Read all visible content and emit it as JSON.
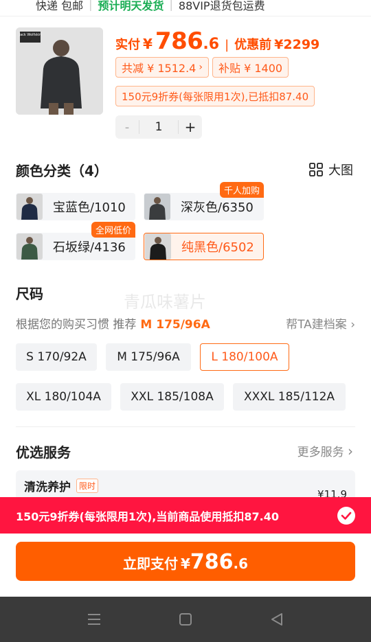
{
  "delivery": {
    "item1": "快递 包邮",
    "item2": "预计明天发货",
    "item3": "88VIP退货包运费"
  },
  "product": {
    "brand_logo": "Jack Wolfskin",
    "paid_label": "实付",
    "currency": "¥",
    "price_int": "786",
    "price_dec": ".6",
    "before_label": "优惠前",
    "before_price": "¥2299",
    "total_discount": "共减 ¥ 1512.4",
    "subsidy": "补贴 ¥ 1400",
    "coupon": "150元9折券(每张限用1次),已抵扣87.40",
    "quantity": "1",
    "minus": "-",
    "plus": "+"
  },
  "colors": {
    "title": "颜色分类（4）",
    "view_big": "大图",
    "options": [
      {
        "name": "宝蓝色/1010",
        "badge": "",
        "selected": false
      },
      {
        "name": "深灰色/6350",
        "badge": "千人加购",
        "selected": false
      },
      {
        "name": "石坂绿/4136",
        "badge": "全网低价",
        "selected": false
      },
      {
        "name": "纯黑色/6502",
        "badge": "",
        "selected": true
      }
    ]
  },
  "sizes": {
    "title": "尺码",
    "recommend_text": "根据您的购买习惯 推荐",
    "recommend_size": "M 175/96A",
    "profile_link": "帮TA建档案",
    "options": [
      {
        "label": "S 170/92A",
        "selected": false
      },
      {
        "label": "M 175/96A",
        "selected": false
      },
      {
        "label": "L 180/100A",
        "selected": true
      },
      {
        "label": "XL 180/104A",
        "selected": false
      },
      {
        "label": "XXL 185/108A",
        "selected": false
      },
      {
        "label": "XXXL 185/112A",
        "selected": false
      }
    ]
  },
  "watermark": "青瓜味薯片",
  "services": {
    "title": "优选服务",
    "more": "更多服务",
    "item_name": "清洗养护",
    "item_tag": "限时",
    "item_price": "¥11.9"
  },
  "coupon_bar": {
    "text": "150元9折券(每张限用1次),当前商品使用抵扣87.40"
  },
  "pay": {
    "label": "立即支付",
    "currency": "¥",
    "price_int": "786",
    "price_dec": ".6"
  },
  "colors_theme": {
    "accent": "#ff5e00",
    "coupon_red": "#ff1540",
    "green": "#1aad54"
  }
}
